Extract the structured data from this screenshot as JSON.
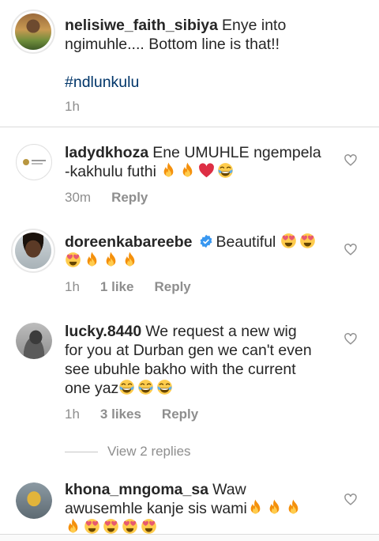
{
  "caption": {
    "username": "nelisiwe_faith_sibiya",
    "text_line1": "Enye into",
    "text_line2": "ngimuhle.... Bottom line is that!!",
    "hashtag": "#ndlunkulu",
    "time": "1h"
  },
  "comments": [
    {
      "username": "ladydkhoza",
      "text_line1": "Ene UMUHLE ngempela",
      "text_line2": "-kakhulu futhi",
      "emojis_line2": [
        "fire",
        "fire",
        "red-heart",
        "joy"
      ],
      "time": "30m",
      "likes": "",
      "reply": "Reply"
    },
    {
      "username": "doreenkabareebe",
      "verified": true,
      "text_line1": "Beautiful",
      "emojis_line1": [
        "heart-eyes",
        "heart-eyes"
      ],
      "emojis_line2": [
        "heart-eyes",
        "fire",
        "fire",
        "fire"
      ],
      "time": "1h",
      "likes": "1 like",
      "reply": "Reply"
    },
    {
      "username": "lucky.8440",
      "text_line1": "We request a new wig",
      "text_line2": "for you at Durban gen we can't even",
      "text_line3": "see ubuhle bakho with the current",
      "text_line4": "one yaz",
      "emojis_line4": [
        "joy",
        "joy",
        "joy"
      ],
      "time": "1h",
      "likes": "3 likes",
      "reply": "Reply"
    },
    {
      "username": "khona_mngoma_sa",
      "text_line1": "Waw",
      "text_line2": "awusemhle kanje sis wami",
      "emojis_line2": [
        "fire",
        "fire",
        "fire"
      ],
      "emojis_line3": [
        "fire",
        "heart-eyes",
        "heart-eyes",
        "heart-eyes",
        "heart-eyes"
      ]
    }
  ],
  "view_replies": "View 2 replies",
  "icons": {
    "like": "heart-outline-icon",
    "verified": "verified-badge-icon"
  },
  "colors": {
    "text": "#262626",
    "muted": "#8e8e8e",
    "hashtag": "#003569",
    "verified": "#3897f0",
    "divider": "#dbdbdb"
  }
}
